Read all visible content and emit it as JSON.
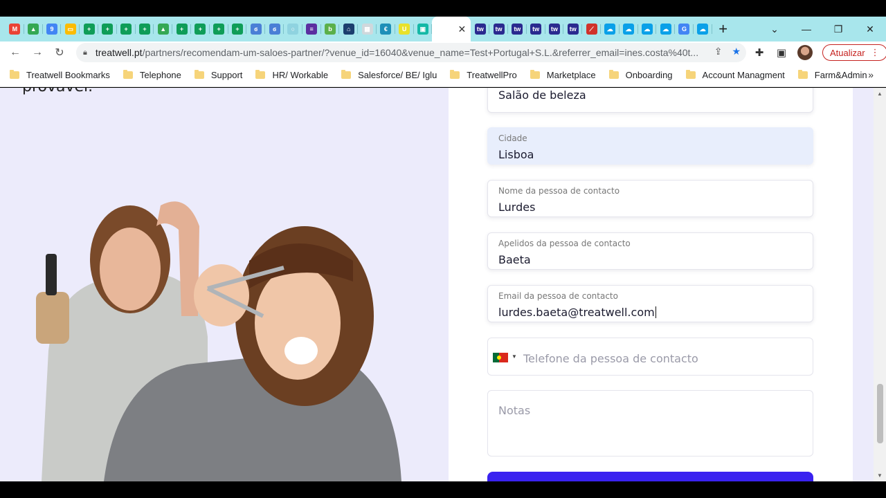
{
  "browser": {
    "tabs": [
      {
        "icon": "gmail-icon",
        "color": "#ea4335",
        "glyph": "M"
      },
      {
        "icon": "drive-icon",
        "color": "#34a853",
        "glyph": "▲"
      },
      {
        "icon": "calendar-icon",
        "color": "#4285f4",
        "glyph": "9"
      },
      {
        "icon": "slides-icon",
        "color": "#fbbc04",
        "glyph": "▭"
      },
      {
        "icon": "sheets-icon",
        "color": "#0f9d58",
        "glyph": "+"
      },
      {
        "icon": "sheets-icon",
        "color": "#0f9d58",
        "glyph": "+"
      },
      {
        "icon": "sheets-icon",
        "color": "#0f9d58",
        "glyph": "+"
      },
      {
        "icon": "sheets-icon",
        "color": "#0f9d58",
        "glyph": "+"
      },
      {
        "icon": "drive-icon",
        "color": "#34a853",
        "glyph": "▲"
      },
      {
        "icon": "sheets-icon",
        "color": "#0f9d58",
        "glyph": "+"
      },
      {
        "icon": "sheets-icon",
        "color": "#0f9d58",
        "glyph": "+"
      },
      {
        "icon": "sheets-icon",
        "color": "#0f9d58",
        "glyph": "+"
      },
      {
        "icon": "sheets-icon",
        "color": "#0f9d58",
        "glyph": "+"
      },
      {
        "icon": "hook-icon",
        "color": "#4a7fd6",
        "glyph": "ϭ"
      },
      {
        "icon": "hook-icon",
        "color": "#4a7fd6",
        "glyph": "ϭ"
      },
      {
        "icon": "circle-icon",
        "color": "#8fd3e0",
        "glyph": "○"
      },
      {
        "icon": "list-icon",
        "color": "#5b2fa0",
        "glyph": "≡"
      },
      {
        "icon": "b-icon",
        "color": "#5bb04a",
        "glyph": "b"
      },
      {
        "icon": "network-icon",
        "color": "#1c3f6e",
        "glyph": "⌂"
      },
      {
        "icon": "grid-icon",
        "color": "#cfd8dc",
        "glyph": "▦"
      },
      {
        "icon": "euro-icon",
        "color": "#1d8fb8",
        "glyph": "€"
      },
      {
        "icon": "u-icon",
        "color": "#e8e12a",
        "glyph": "U"
      },
      {
        "icon": "tw-icon",
        "color": "#14b8a6",
        "glyph": "▣"
      }
    ],
    "active_tab_close": "✕",
    "tabs_after": [
      {
        "icon": "treatwell-icon",
        "color": "#2a2a8f",
        "glyph": "tw"
      },
      {
        "icon": "treatwell-icon",
        "color": "#2a2a8f",
        "glyph": "tw"
      },
      {
        "icon": "treatwell-icon",
        "color": "#2a2a8f",
        "glyph": "tw"
      },
      {
        "icon": "treatwell-icon",
        "color": "#2a2a8f",
        "glyph": "tw"
      },
      {
        "icon": "treatwell-icon",
        "color": "#2a2a8f",
        "glyph": "tw"
      },
      {
        "icon": "treatwell-icon",
        "color": "#2a2a8f",
        "glyph": "tw"
      },
      {
        "icon": "tool-icon",
        "color": "#d0322b",
        "glyph": "⟋"
      },
      {
        "icon": "salesforce-icon",
        "color": "#0aa0e8",
        "glyph": "☁"
      },
      {
        "icon": "salesforce-icon",
        "color": "#0aa0e8",
        "glyph": "☁"
      },
      {
        "icon": "salesforce-icon",
        "color": "#0aa0e8",
        "glyph": "☁"
      },
      {
        "icon": "salesforce-icon",
        "color": "#0aa0e8",
        "glyph": "☁"
      },
      {
        "icon": "translate-icon",
        "color": "#4285f4",
        "glyph": "G"
      },
      {
        "icon": "salesforce-icon",
        "color": "#0aa0e8",
        "glyph": "☁"
      }
    ],
    "new_tab": "+",
    "window_controls": {
      "chevron": "⌄",
      "minimize": "—",
      "restore": "❐",
      "close": "✕"
    },
    "url_host": "treatwell.pt",
    "url_path": "/partners/recomendam-um-saloes-partner/?venue_id=16040&venue_name=Test+Portugal+S.L.&referrer_email=ines.costa%40t...",
    "update_label": "Atualizar",
    "bookmarks": [
      "Treatwell Bookmarks",
      "Telephone",
      "Support",
      "HR/ Workable",
      "Salesforce/ BE/ Iglu",
      "TreatwellPro",
      "Marketplace",
      "Onboarding",
      "Account Managment",
      "Farm&Admin"
    ],
    "bookmarks_more": "»"
  },
  "page": {
    "promo_text": "provável.",
    "form": {
      "venue_type_value": "Salão de beleza",
      "city": {
        "label": "Cidade",
        "value": "Lisboa"
      },
      "contact_first_name": {
        "label": "Nome da pessoa de contacto",
        "value": "Lurdes"
      },
      "contact_last_name": {
        "label": "Apelidos da pessoa de contacto",
        "value": "Baeta"
      },
      "contact_email": {
        "label": "Email da pessoa de contacto",
        "value": "lurdes.baeta@treatwell.com"
      },
      "phone": {
        "placeholder": "Telefone da pessoa de contacto",
        "country": "Portugal"
      },
      "notes": {
        "placeholder": "Notas"
      }
    },
    "colors": {
      "accent": "#3a22f0",
      "panel_bg": "#ecebfb",
      "focused_field": "#e8eefc"
    }
  }
}
